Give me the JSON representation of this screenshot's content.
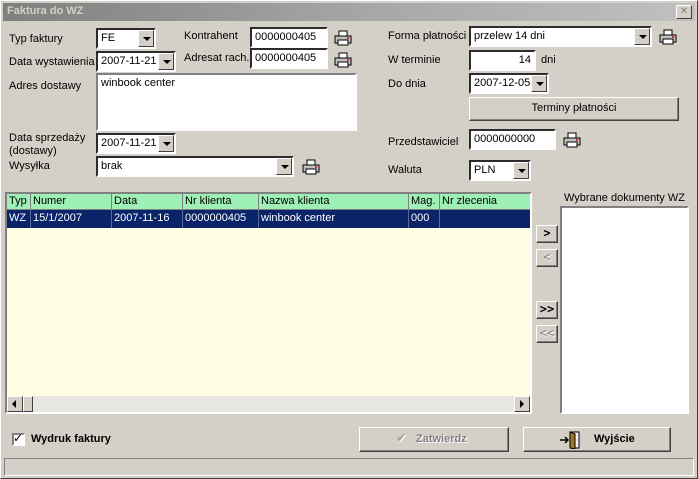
{
  "window": {
    "title": "Faktura do WZ",
    "close_label": "✕"
  },
  "form": {
    "typ_faktury": {
      "label": "Typ faktury",
      "value": "FE"
    },
    "data_wystawienia": {
      "label": "Data wystawienia",
      "value": "2007-11-21"
    },
    "kontrahent": {
      "label": "Kontrahent",
      "value": "0000000405"
    },
    "adresat": {
      "label": "Adresat rach.",
      "value": "0000000405"
    },
    "adres_dostawy": {
      "label": "Adres dostawy",
      "value": "winbook center"
    },
    "data_sprzedazy": {
      "label_line1": "Data sprzedaży",
      "label_line2": "(dostawy)",
      "value": "2007-11-21"
    },
    "wysylka": {
      "label": "Wysyłka",
      "value": "brak"
    },
    "forma_platnosci": {
      "label": "Forma płatności",
      "value": "przelew 14 dni"
    },
    "w_terminie": {
      "label": "W terminie",
      "value": "14",
      "unit": "dni"
    },
    "do_dnia": {
      "label": "Do dnia",
      "value": "2007-12-05"
    },
    "terminy_button": "Terminy płatności",
    "przedstawiciel": {
      "label": "Przedstawiciel",
      "value": "0000000000"
    },
    "waluta": {
      "label": "Waluta",
      "value": "PLN"
    }
  },
  "grid": {
    "columns": [
      "Typ",
      "Numer",
      "Data",
      "Nr klienta",
      "Nazwa klienta",
      "Mag.",
      "Nr zlecenia"
    ],
    "rows": [
      [
        "WZ",
        "15/1/2007",
        "2007-11-16",
        "0000000405",
        "winbook center",
        "000",
        ""
      ]
    ]
  },
  "selected_docs": {
    "label": "Wybrane dokumenty WZ"
  },
  "move_buttons": {
    "add_one": ">",
    "remove_one": "<",
    "add_all": ">>",
    "remove_all": "<<"
  },
  "footer": {
    "print_checkbox": {
      "label": "Wydruk faktury",
      "checked": true
    },
    "confirm_button": "Zatwierdz",
    "exit_button": "Wyjście"
  },
  "icons": {
    "printer": "printer-icon",
    "checkmark": "checkmark-icon",
    "exit_door": "exit-door-icon"
  }
}
